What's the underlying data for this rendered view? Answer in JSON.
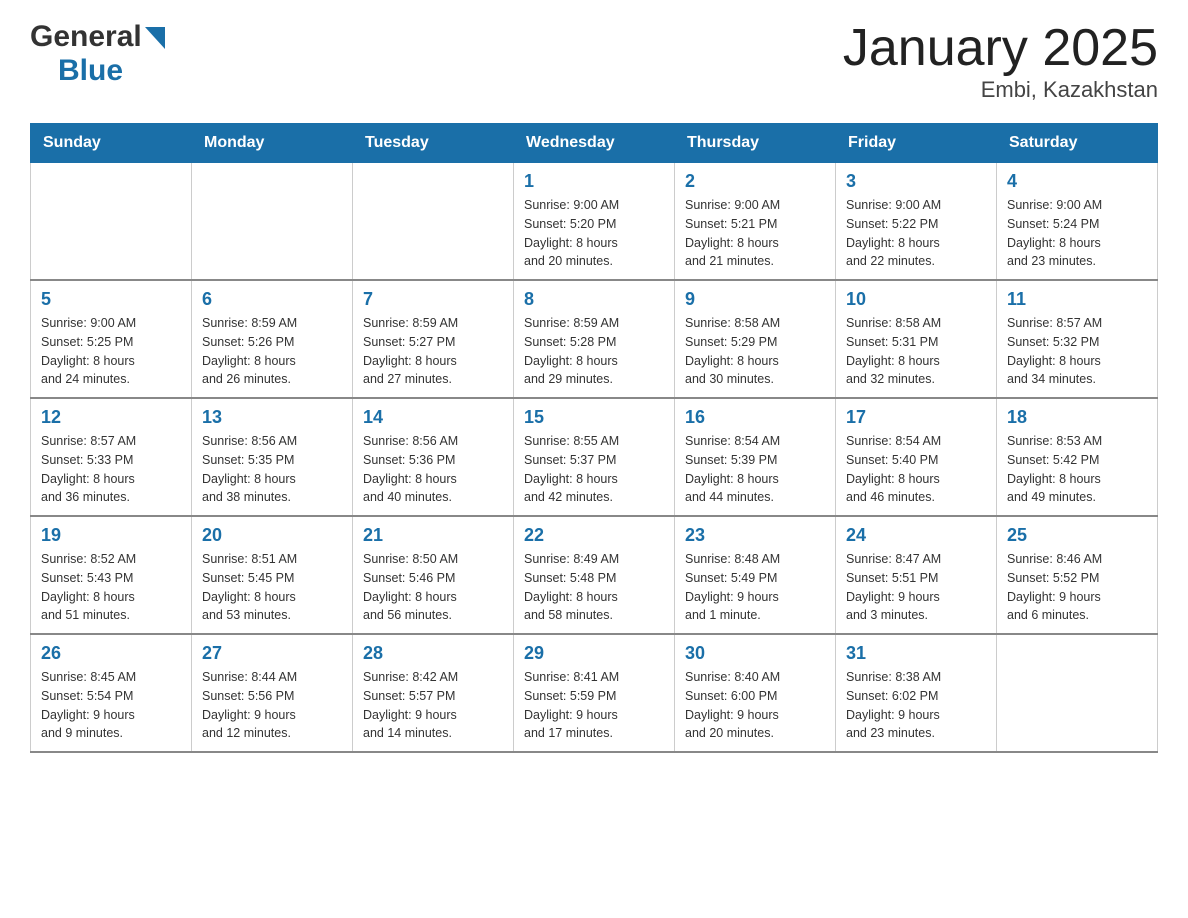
{
  "header": {
    "logo_general": "General",
    "logo_blue": "Blue",
    "title": "January 2025",
    "subtitle": "Embi, Kazakhstan"
  },
  "days_of_week": [
    "Sunday",
    "Monday",
    "Tuesday",
    "Wednesday",
    "Thursday",
    "Friday",
    "Saturday"
  ],
  "weeks": [
    [
      {
        "day": "",
        "info": ""
      },
      {
        "day": "",
        "info": ""
      },
      {
        "day": "",
        "info": ""
      },
      {
        "day": "1",
        "info": "Sunrise: 9:00 AM\nSunset: 5:20 PM\nDaylight: 8 hours\nand 20 minutes."
      },
      {
        "day": "2",
        "info": "Sunrise: 9:00 AM\nSunset: 5:21 PM\nDaylight: 8 hours\nand 21 minutes."
      },
      {
        "day": "3",
        "info": "Sunrise: 9:00 AM\nSunset: 5:22 PM\nDaylight: 8 hours\nand 22 minutes."
      },
      {
        "day": "4",
        "info": "Sunrise: 9:00 AM\nSunset: 5:24 PM\nDaylight: 8 hours\nand 23 minutes."
      }
    ],
    [
      {
        "day": "5",
        "info": "Sunrise: 9:00 AM\nSunset: 5:25 PM\nDaylight: 8 hours\nand 24 minutes."
      },
      {
        "day": "6",
        "info": "Sunrise: 8:59 AM\nSunset: 5:26 PM\nDaylight: 8 hours\nand 26 minutes."
      },
      {
        "day": "7",
        "info": "Sunrise: 8:59 AM\nSunset: 5:27 PM\nDaylight: 8 hours\nand 27 minutes."
      },
      {
        "day": "8",
        "info": "Sunrise: 8:59 AM\nSunset: 5:28 PM\nDaylight: 8 hours\nand 29 minutes."
      },
      {
        "day": "9",
        "info": "Sunrise: 8:58 AM\nSunset: 5:29 PM\nDaylight: 8 hours\nand 30 minutes."
      },
      {
        "day": "10",
        "info": "Sunrise: 8:58 AM\nSunset: 5:31 PM\nDaylight: 8 hours\nand 32 minutes."
      },
      {
        "day": "11",
        "info": "Sunrise: 8:57 AM\nSunset: 5:32 PM\nDaylight: 8 hours\nand 34 minutes."
      }
    ],
    [
      {
        "day": "12",
        "info": "Sunrise: 8:57 AM\nSunset: 5:33 PM\nDaylight: 8 hours\nand 36 minutes."
      },
      {
        "day": "13",
        "info": "Sunrise: 8:56 AM\nSunset: 5:35 PM\nDaylight: 8 hours\nand 38 minutes."
      },
      {
        "day": "14",
        "info": "Sunrise: 8:56 AM\nSunset: 5:36 PM\nDaylight: 8 hours\nand 40 minutes."
      },
      {
        "day": "15",
        "info": "Sunrise: 8:55 AM\nSunset: 5:37 PM\nDaylight: 8 hours\nand 42 minutes."
      },
      {
        "day": "16",
        "info": "Sunrise: 8:54 AM\nSunset: 5:39 PM\nDaylight: 8 hours\nand 44 minutes."
      },
      {
        "day": "17",
        "info": "Sunrise: 8:54 AM\nSunset: 5:40 PM\nDaylight: 8 hours\nand 46 minutes."
      },
      {
        "day": "18",
        "info": "Sunrise: 8:53 AM\nSunset: 5:42 PM\nDaylight: 8 hours\nand 49 minutes."
      }
    ],
    [
      {
        "day": "19",
        "info": "Sunrise: 8:52 AM\nSunset: 5:43 PM\nDaylight: 8 hours\nand 51 minutes."
      },
      {
        "day": "20",
        "info": "Sunrise: 8:51 AM\nSunset: 5:45 PM\nDaylight: 8 hours\nand 53 minutes."
      },
      {
        "day": "21",
        "info": "Sunrise: 8:50 AM\nSunset: 5:46 PM\nDaylight: 8 hours\nand 56 minutes."
      },
      {
        "day": "22",
        "info": "Sunrise: 8:49 AM\nSunset: 5:48 PM\nDaylight: 8 hours\nand 58 minutes."
      },
      {
        "day": "23",
        "info": "Sunrise: 8:48 AM\nSunset: 5:49 PM\nDaylight: 9 hours\nand 1 minute."
      },
      {
        "day": "24",
        "info": "Sunrise: 8:47 AM\nSunset: 5:51 PM\nDaylight: 9 hours\nand 3 minutes."
      },
      {
        "day": "25",
        "info": "Sunrise: 8:46 AM\nSunset: 5:52 PM\nDaylight: 9 hours\nand 6 minutes."
      }
    ],
    [
      {
        "day": "26",
        "info": "Sunrise: 8:45 AM\nSunset: 5:54 PM\nDaylight: 9 hours\nand 9 minutes."
      },
      {
        "day": "27",
        "info": "Sunrise: 8:44 AM\nSunset: 5:56 PM\nDaylight: 9 hours\nand 12 minutes."
      },
      {
        "day": "28",
        "info": "Sunrise: 8:42 AM\nSunset: 5:57 PM\nDaylight: 9 hours\nand 14 minutes."
      },
      {
        "day": "29",
        "info": "Sunrise: 8:41 AM\nSunset: 5:59 PM\nDaylight: 9 hours\nand 17 minutes."
      },
      {
        "day": "30",
        "info": "Sunrise: 8:40 AM\nSunset: 6:00 PM\nDaylight: 9 hours\nand 20 minutes."
      },
      {
        "day": "31",
        "info": "Sunrise: 8:38 AM\nSunset: 6:02 PM\nDaylight: 9 hours\nand 23 minutes."
      },
      {
        "day": "",
        "info": ""
      }
    ]
  ]
}
